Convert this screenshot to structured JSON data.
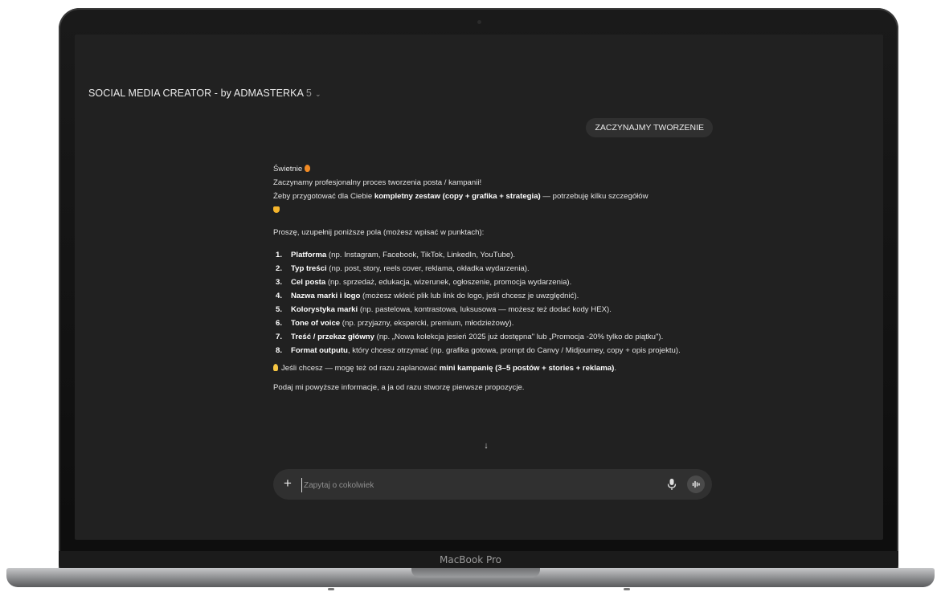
{
  "device": {
    "brand": "MacBook Pro"
  },
  "header": {
    "title": "SOCIAL MEDIA CREATOR - by ADMASTERKA",
    "version": "5"
  },
  "chat": {
    "user_message": "ZACZYNAJMY TWORZENIE",
    "assistant": {
      "greeting": "Świetnie",
      "line1": "Zaczynamy profesjonalny proces tworzenia posta / kampanii!",
      "line2_a": "Żeby przygotować dla Ciebie ",
      "line2_b": "kompletny zestaw (copy + grafika + strategia)",
      "line2_c": " — potrzebuję kilku szczegółów",
      "intro": "Proszę, uzupełnij poniższe pola (możesz wpisać w punktach):",
      "items": [
        {
          "num": "1.",
          "bold": "Platforma",
          "rest": " (np. Instagram, Facebook, TikTok, LinkedIn, YouTube)."
        },
        {
          "num": "2.",
          "bold": "Typ treści",
          "rest": " (np. post, story, reels cover, reklama, okładka wydarzenia)."
        },
        {
          "num": "3.",
          "bold": "Cel posta",
          "rest": " (np. sprzedaż, edukacja, wizerunek, ogłoszenie, promocja wydarzenia)."
        },
        {
          "num": "4.",
          "bold": "Nazwa marki i logo",
          "rest": " (możesz wkleić plik lub link do logo, jeśli chcesz je uwzględnić)."
        },
        {
          "num": "5.",
          "bold": "Kolorystyka marki",
          "rest": " (np. pastelowa, kontrastowa, luksusowa — możesz też dodać kody HEX)."
        },
        {
          "num": "6.",
          "bold": "Tone of voice",
          "rest": " (np. przyjazny, ekspercki, premium, młodzieżowy)."
        },
        {
          "num": "7.",
          "bold": "Treść / przekaz główny",
          "rest": " (np. „Nowa kolekcja jesień 2025 już dostępna\" lub „Promocja -20% tylko do piątku\")."
        },
        {
          "num": "8.",
          "bold": "Format outputu",
          "rest": ", który chcesz otrzymać (np. grafika gotowa, prompt do Canvy / Midjourney, copy + opis projektu)."
        }
      ],
      "tip_a": "Jeśli chcesz — mogę też od razu zaplanować ",
      "tip_b": "mini kampanię (3–5 postów + stories + reklama)",
      "tip_c": ".",
      "closing": "Podaj mi powyższe informacje, a ja od razu stworzę pierwsze propozycje."
    }
  },
  "composer": {
    "placeholder": "Zapytaj o cokolwiek",
    "value": ""
  },
  "icons": {
    "plus": "plus-icon",
    "mic": "microphone-icon",
    "voice": "voice-mode-icon",
    "arrow": "arrow-down-icon",
    "chevron": "chevron-down-icon"
  },
  "colors": {
    "screen_bg": "#212121",
    "bubble_bg": "#303030",
    "text": "#e3e3e3"
  }
}
